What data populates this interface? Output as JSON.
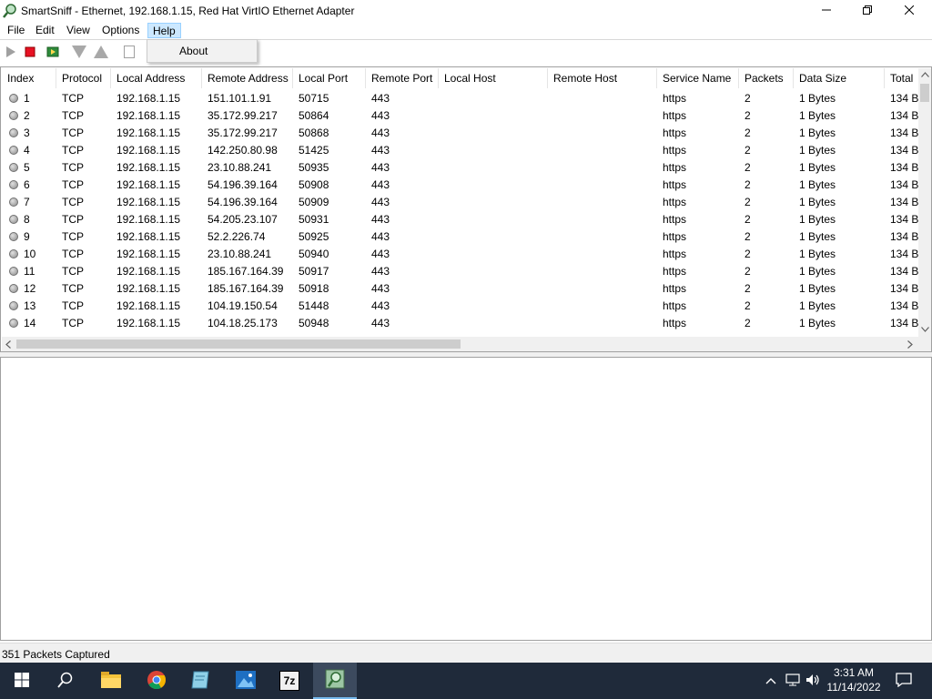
{
  "window": {
    "title": "SmartSniff  -  Ethernet, 192.168.1.15, Red Hat VirtIO Ethernet Adapter",
    "icons": [
      "app-magnifier-icon",
      "minimize-icon",
      "restore-icon",
      "close-icon"
    ]
  },
  "menu": {
    "file": "File",
    "edit": "Edit",
    "view": "View",
    "options": "Options",
    "help": "Help",
    "help_items": [
      "About"
    ]
  },
  "toolbar": {
    "icons": [
      "play-icon",
      "stop-icon",
      "refresh-icon",
      "down-triangle-icon",
      "up-triangle-icon",
      "page-icon"
    ]
  },
  "table": {
    "columns": [
      "Index",
      "Protocol",
      "Local Address",
      "Remote Address",
      "Local Port",
      "Remote Port",
      "Local Host",
      "Remote Host",
      "Service Name",
      "Packets",
      "Data Size",
      "Total"
    ],
    "rows": [
      [
        "1",
        "TCP",
        "192.168.1.15",
        "151.101.1.91",
        "50715",
        "443",
        "",
        "",
        "https",
        "2",
        "1 Bytes",
        "134 B"
      ],
      [
        "2",
        "TCP",
        "192.168.1.15",
        "35.172.99.217",
        "50864",
        "443",
        "",
        "",
        "https",
        "2",
        "1 Bytes",
        "134 B"
      ],
      [
        "3",
        "TCP",
        "192.168.1.15",
        "35.172.99.217",
        "50868",
        "443",
        "",
        "",
        "https",
        "2",
        "1 Bytes",
        "134 B"
      ],
      [
        "4",
        "TCP",
        "192.168.1.15",
        "142.250.80.98",
        "51425",
        "443",
        "",
        "",
        "https",
        "2",
        "1 Bytes",
        "134 B"
      ],
      [
        "5",
        "TCP",
        "192.168.1.15",
        "23.10.88.241",
        "50935",
        "443",
        "",
        "",
        "https",
        "2",
        "1 Bytes",
        "134 B"
      ],
      [
        "6",
        "TCP",
        "192.168.1.15",
        "54.196.39.164",
        "50908",
        "443",
        "",
        "",
        "https",
        "2",
        "1 Bytes",
        "134 B"
      ],
      [
        "7",
        "TCP",
        "192.168.1.15",
        "54.196.39.164",
        "50909",
        "443",
        "",
        "",
        "https",
        "2",
        "1 Bytes",
        "134 B"
      ],
      [
        "8",
        "TCP",
        "192.168.1.15",
        "54.205.23.107",
        "50931",
        "443",
        "",
        "",
        "https",
        "2",
        "1 Bytes",
        "134 B"
      ],
      [
        "9",
        "TCP",
        "192.168.1.15",
        "52.2.226.74",
        "50925",
        "443",
        "",
        "",
        "https",
        "2",
        "1 Bytes",
        "134 B"
      ],
      [
        "10",
        "TCP",
        "192.168.1.15",
        "23.10.88.241",
        "50940",
        "443",
        "",
        "",
        "https",
        "2",
        "1 Bytes",
        "134 B"
      ],
      [
        "11",
        "TCP",
        "192.168.1.15",
        "185.167.164.39",
        "50917",
        "443",
        "",
        "",
        "https",
        "2",
        "1 Bytes",
        "134 B"
      ],
      [
        "12",
        "TCP",
        "192.168.1.15",
        "185.167.164.39",
        "50918",
        "443",
        "",
        "",
        "https",
        "2",
        "1 Bytes",
        "134 B"
      ],
      [
        "13",
        "TCP",
        "192.168.1.15",
        "104.19.150.54",
        "51448",
        "443",
        "",
        "",
        "https",
        "2",
        "1 Bytes",
        "134 B"
      ],
      [
        "14",
        "TCP",
        "192.168.1.15",
        "104.18.25.173",
        "50948",
        "443",
        "",
        "",
        "https",
        "2",
        "1 Bytes",
        "134 B"
      ]
    ]
  },
  "status": {
    "text": "351 Packets Captured"
  },
  "taskbar": {
    "time": "3:31 AM",
    "date": "11/14/2022",
    "icons": [
      "windows-start-icon",
      "search-icon",
      "file-explorer-icon",
      "chrome-icon",
      "notepad-icon",
      "photos-icon",
      "7zip-icon",
      "smartsniff-icon",
      "chevron-up-icon",
      "network-icon",
      "volume-icon",
      "notification-icon"
    ],
    "sevenzip_label": "7z"
  },
  "colors": {
    "taskbar_bg": "#1f2a3a",
    "menu_highlight": "#cce8ff",
    "accent": "#76b9ed"
  }
}
